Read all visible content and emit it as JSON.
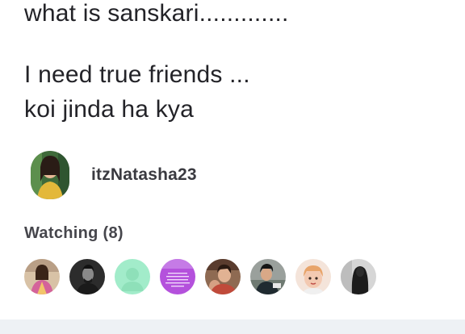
{
  "post": {
    "line1": "what is sanskari.............",
    "line2": "I need true friends ...",
    "line3": "koi jinda ha kya"
  },
  "author": {
    "username": "itzNatasha23",
    "avatar_icon": "profile-photo"
  },
  "watching": {
    "title": "Watching",
    "count": "(8)",
    "watchers": [
      {
        "icon": "watcher-photo-1",
        "accent": "#c9b49a"
      },
      {
        "icon": "watcher-photo-2",
        "accent": "#2a2a2a"
      },
      {
        "icon": "default-avatar-icon",
        "accent": "#9ee6c6"
      },
      {
        "icon": "watcher-text-card",
        "accent": "#b24fd8"
      },
      {
        "icon": "watcher-photo-5",
        "accent": "#7a5a48"
      },
      {
        "icon": "watcher-photo-6",
        "accent": "#8a8f8c"
      },
      {
        "icon": "watcher-photo-7",
        "accent": "#f1d6c8"
      },
      {
        "icon": "watcher-photo-8",
        "accent": "#3b3b3b"
      }
    ]
  },
  "colors": {
    "text": "#232328",
    "footer": "#eef1f5"
  }
}
